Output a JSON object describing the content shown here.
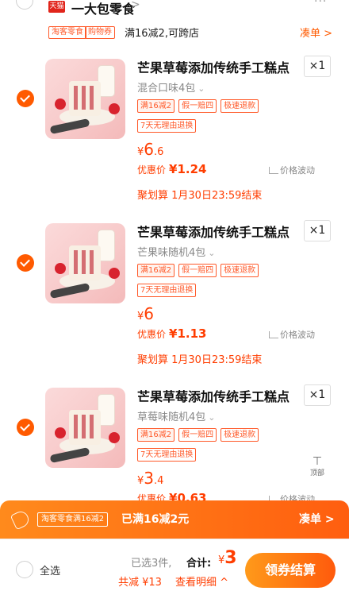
{
  "shop": {
    "badge": "天猫",
    "name": "一大包零食",
    "chevron": ">",
    "more": "···"
  },
  "promo": {
    "tag1": "淘客零食",
    "tag2": "购物券",
    "text": "满16减2,可跨店",
    "coudan": "凑单 >"
  },
  "items": [
    {
      "title": "芒果草莓添加传统手工糕点",
      "qty": "×1",
      "sku": "混合口味4包",
      "badges": [
        "满16减2",
        "假一赔四",
        "极速退款"
      ],
      "return": "7天无理由退换",
      "price_sym": "¥",
      "price_int": "6",
      "price_dec": ".6",
      "youhui_label": "优惠价",
      "youhui_val": "¥1.24",
      "fluct": "价格波动",
      "juhuasuan": "聚划算 1月30日23:59结束",
      "checked": true
    },
    {
      "title": "芒果草莓添加传统手工糕点",
      "qty": "×1",
      "sku": "芒果味随机4包",
      "badges": [
        "满16减2",
        "假一赔四",
        "极速退款"
      ],
      "return": "7天无理由退换",
      "price_sym": "¥",
      "price_int": "6",
      "price_dec": "",
      "youhui_label": "优惠价",
      "youhui_val": "¥1.13",
      "fluct": "价格波动",
      "juhuasuan": "聚划算 1月30日23:59结束",
      "checked": true
    },
    {
      "title": "芒果草莓添加传统手工糕点",
      "qty": "×1",
      "sku": "草莓味随机4包",
      "badges": [
        "满16减2",
        "假一赔四",
        "极速退款"
      ],
      "return": "7天无理由退换",
      "price_sym": "¥",
      "price_int": "3",
      "price_dec": ".4",
      "youhui_label": "优惠价",
      "youhui_val": "¥0.63",
      "fluct": "价格波动",
      "checked": true
    }
  ],
  "to_top": {
    "arrow": "⊤",
    "label": "顶部"
  },
  "promo_bar": {
    "tag": "淘客零食满16减2",
    "text": "已满16减2元",
    "right": "凑单 >"
  },
  "bottom": {
    "select_all": "全选",
    "selected": "已选3件,",
    "total_label": "合计:",
    "total_sym": "¥",
    "total_int": "3",
    "discount": "共减 ¥13",
    "detail": "查看明细 ^",
    "checkout": "领券结算"
  },
  "colors": {
    "accent": "#ff5a00",
    "price": "#ff3d00"
  }
}
